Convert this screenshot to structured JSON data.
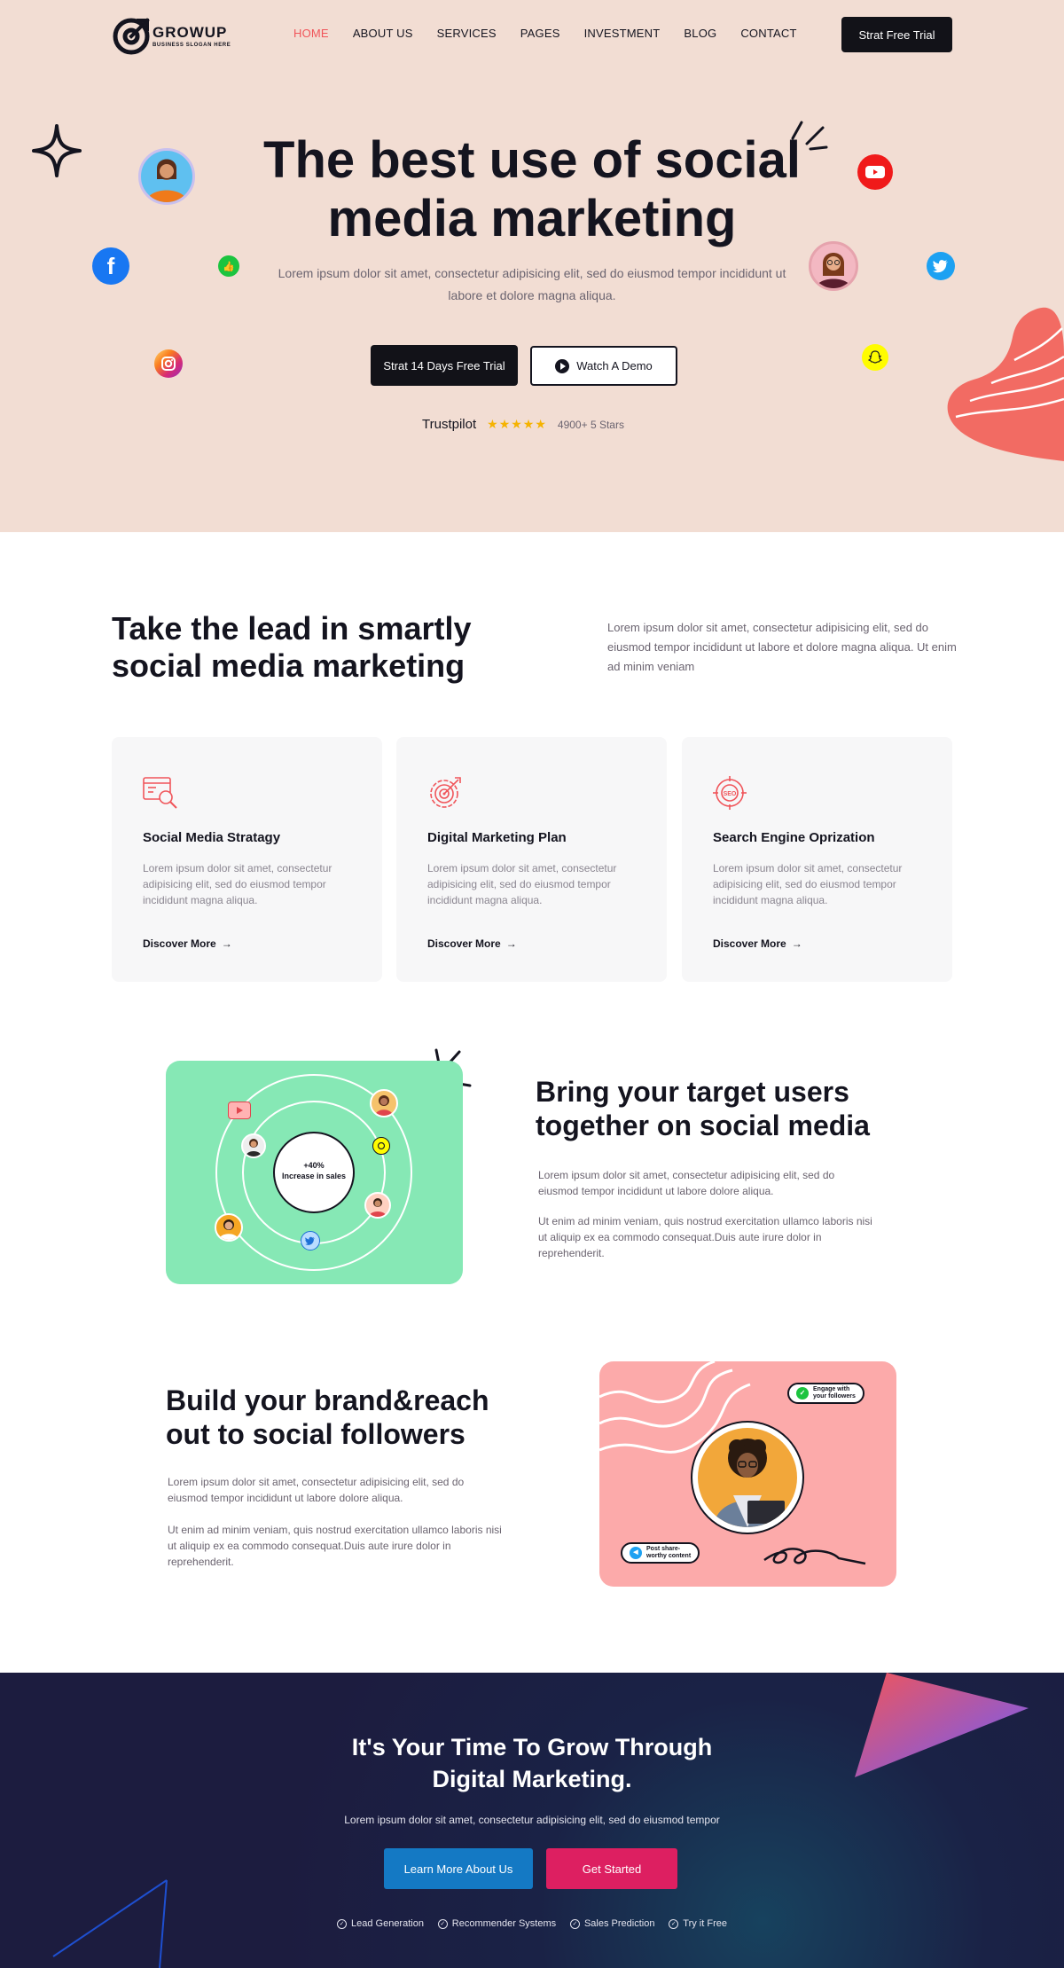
{
  "header": {
    "brand": "GROWUP",
    "slogan": "BUSINESS SLOGAN HERE",
    "nav": [
      "HOME",
      "ABOUT US",
      "SERVICES",
      "PAGES",
      "INVESTMENT",
      "BLOG",
      "CONTACT"
    ],
    "active_nav": "HOME",
    "cta_label": "Strat Free Trial"
  },
  "hero": {
    "title_line1": "The best use of social",
    "title_line2": "media marketing",
    "description": "Lorem ipsum dolor sit amet, consectetur adipisicing elit, sed do eiusmod tempor incididunt ut labore et dolore magna aliqua.",
    "primary_button": "Strat 14 Days Free Trial",
    "secondary_button": "Watch A Demo",
    "trust_brand": "Trustpilot",
    "rating_stars": 5,
    "rating_text": "4900+ 5 Stars",
    "social_icons": [
      "facebook-icon",
      "instagram-icon",
      "like-icon",
      "youtube-icon",
      "twitter-icon",
      "snapchat-icon"
    ]
  },
  "lead": {
    "title_line1": "Take the lead in smartly",
    "title_line2": "social media marketing",
    "description": "Lorem ipsum dolor sit amet, consectetur adipisicing elit, sed do eiusmod tempor incididunt ut labore et dolore magna aliqua. Ut enim ad minim veniam"
  },
  "services": [
    {
      "title": "Social Media Stratagy",
      "description": "Lorem ipsum dolor sit amet, consectetur adipisicing elit, sed do eiusmod tempor incididunt magna aliqua.",
      "link": "Discover More",
      "icon": "strategy-icon"
    },
    {
      "title": "Digital Marketing Plan",
      "description": "Lorem ipsum dolor sit amet, consectetur adipisicing elit, sed do eiusmod tempor incididunt magna aliqua.",
      "link": "Discover More",
      "icon": "target-gear-icon"
    },
    {
      "title": "Search Engine Oprization",
      "description": "Lorem ipsum dolor sit amet, consectetur adipisicing elit, sed do eiusmod tempor incididunt magna aliqua.",
      "link": "Discover More",
      "icon": "seo-icon"
    }
  ],
  "target": {
    "title_line1": "Bring your target users",
    "title_line2": "together on social media",
    "paragraph1": "Lorem ipsum dolor sit amet, consectetur adipisicing elit, sed do eiusmod tempor incididunt ut labore dolore aliqua.",
    "paragraph2": "Ut enim ad minim veniam, quis nostrud exercitation ullamco laboris nisi ut aliquip ex ea commodo consequat.Duis aute irure dolor in reprehenderit.",
    "orbit_stat": "+40%",
    "orbit_label": "Increase in sales"
  },
  "brand": {
    "title_line1": "Build your brand&reach",
    "title_line2": "out to social followers",
    "paragraph1": "Lorem ipsum dolor sit amet, consectetur adipisicing elit, sed do eiusmod tempor incididunt ut labore dolore aliqua.",
    "paragraph2": "Ut enim ad minim veniam, quis nostrud exercitation ullamco laboris nisi ut aliquip ex ea commodo consequat.Duis aute irure dolor in reprehenderit.",
    "pill_top_line1": "Engage with",
    "pill_top_line2": "your followers",
    "pill_bottom_line1": "Post share-",
    "pill_bottom_line2": "worthy content"
  },
  "cta": {
    "title_line1": "It's Your Time To Grow Through",
    "title_line2": "Digital Marketing.",
    "description": "Lorem ipsum dolor sit amet, consectetur adipisicing elit, sed do eiusmod tempor",
    "learn_button": "Learn More About Us",
    "start_button": "Get Started",
    "features": [
      "Lead Generation",
      "Recommender Systems",
      "Sales Prediction",
      "Try it Free"
    ]
  },
  "colors": {
    "hero_bg": "#f2ddd3",
    "accent_red": "#f0555a",
    "dark": "#121218",
    "mint": "#86e8b5",
    "pink": "#fcaaaa",
    "cta_bg": "#1c1c3f",
    "blue_button": "#1479c4",
    "magenta_button": "#dd1f61"
  }
}
